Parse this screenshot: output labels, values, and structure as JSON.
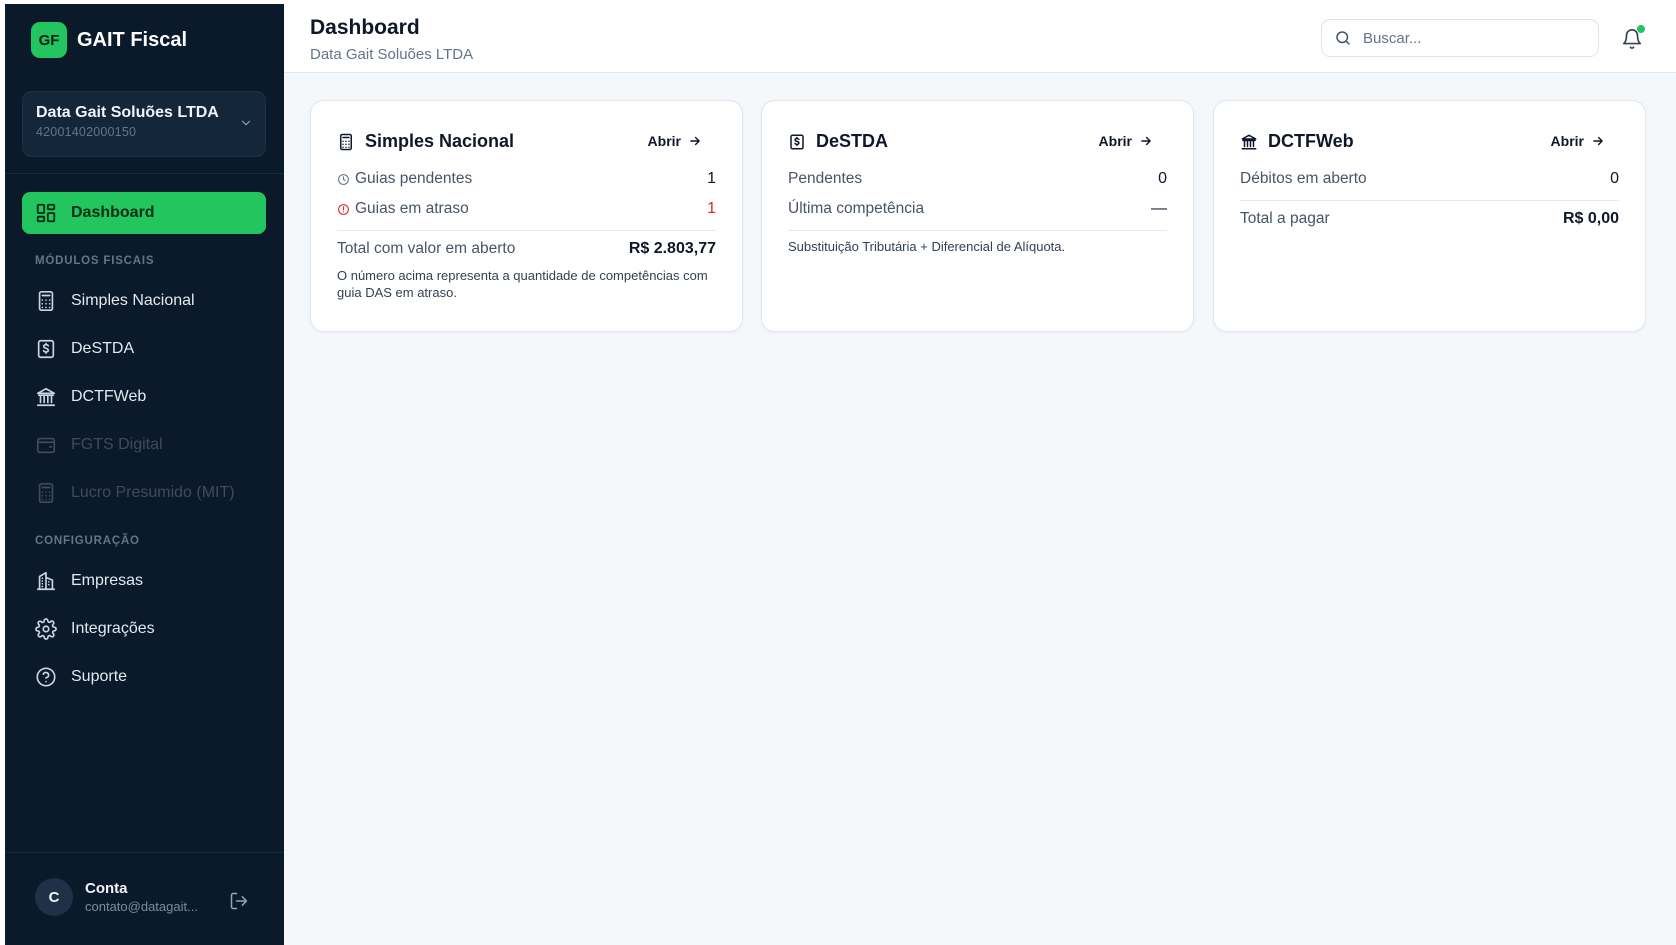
{
  "brand": {
    "logo_text": "GF",
    "name": "GAIT Fiscal"
  },
  "company": {
    "name": "Data Gait Soluões LTDA",
    "cnpj": "42001402000150"
  },
  "nav": {
    "dashboard": "Dashboard",
    "section_modules": "MÓDULOS FISCAIS",
    "simples": "Simples Nacional",
    "destda": "DeSTDA",
    "dctfweb": "DCTFWeb",
    "fgts": "FGTS Digital",
    "lucro": "Lucro Presumido (MIT)",
    "section_config": "CONFIGURAÇÃO",
    "empresas": "Empresas",
    "integracoes": "Integrações",
    "suporte": "Suporte"
  },
  "account": {
    "initial": "C",
    "name": "Conta",
    "email": "contato@datagait..."
  },
  "header": {
    "title": "Dashboard",
    "subtitle": "Data Gait Soluões LTDA"
  },
  "search": {
    "placeholder": "Buscar..."
  },
  "cards": {
    "simples": {
      "title": "Simples Nacional",
      "open": "Abrir",
      "pending_label": "Guias pendentes",
      "pending_value": "1",
      "late_label": "Guias em atraso",
      "late_value": "1",
      "total_label": "Total com valor em aberto",
      "total_value": "R$ 2.803,77",
      "note": "O número acima representa a quantidade de competências com guia DAS em atraso."
    },
    "destda": {
      "title": "DeSTDA",
      "open": "Abrir",
      "pending_label": "Pendentes",
      "pending_value": "0",
      "last_label": "Última competência",
      "last_value": "—",
      "note": "Substituição Tributária + Diferencial de Alíquota."
    },
    "dctfweb": {
      "title": "DCTFWeb",
      "open": "Abrir",
      "debts_label": "Débitos em aberto",
      "debts_value": "0",
      "total_label": "Total a pagar",
      "total_value": "R$ 0,00"
    }
  },
  "colors": {
    "accent": "#22c55e",
    "sidebar": "#0b1a2b",
    "danger": "#dc2626"
  }
}
